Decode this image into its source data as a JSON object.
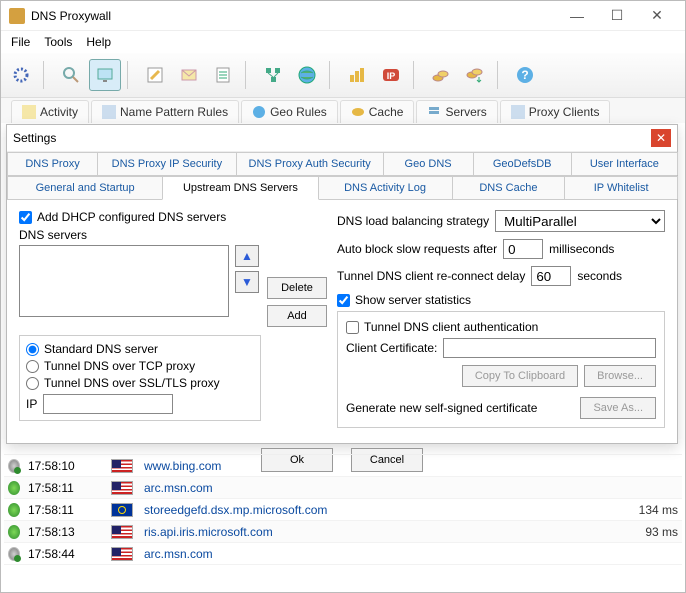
{
  "window": {
    "title": "DNS Proxywall"
  },
  "menu": {
    "file": "File",
    "tools": "Tools",
    "help": "Help"
  },
  "maintabs": {
    "activity": "Activity",
    "name_rules": "Name Pattern Rules",
    "geo_rules": "Geo Rules",
    "cache": "Cache",
    "servers": "Servers",
    "proxy_clients": "Proxy Clients"
  },
  "dialog": {
    "title": "Settings",
    "row1": {
      "dns_proxy": "DNS Proxy",
      "ip_security": "DNS Proxy IP Security",
      "auth_security": "DNS Proxy Auth Security",
      "geo_dns": "Geo DNS",
      "geo_defs": "GeoDefsDB",
      "user_interface": "User Interface"
    },
    "row2": {
      "general": "General and Startup",
      "upstream": "Upstream DNS Servers",
      "activity_log": "DNS Activity Log",
      "dns_cache": "DNS Cache",
      "ip_whitelist": "IP Whitelist"
    },
    "left": {
      "add_dhcp": "Add DHCP configured DNS servers",
      "dns_servers": "DNS servers",
      "delete": "Delete",
      "add": "Add",
      "std": "Standard DNS server",
      "tcp": "Tunnel DNS over TCP proxy",
      "ssl": "Tunnel DNS over SSL/TLS proxy",
      "ip": "IP"
    },
    "right": {
      "load_bal": "DNS load balancing strategy",
      "load_bal_val": "MultiParallel",
      "auto_block": "Auto block slow requests after",
      "auto_block_val": "0",
      "ms": "milliseconds",
      "reconnect": "Tunnel DNS client re-connect delay",
      "reconnect_val": "60",
      "sec": "seconds",
      "show_stats": "Show server statistics",
      "tunnel_auth": "Tunnel DNS client authentication",
      "client_cert": "Client Certificate:",
      "copy": "Copy To Clipboard",
      "browse": "Browse...",
      "gen": "Generate new self-signed certificate",
      "save_as": "Save As..."
    },
    "buttons": {
      "ok": "Ok",
      "cancel": "Cancel"
    }
  },
  "log": [
    {
      "time": "17:58:10",
      "flag": "us",
      "host": "www.bing.com",
      "ms": "",
      "status": "gray"
    },
    {
      "time": "17:58:11",
      "flag": "us",
      "host": "arc.msn.com",
      "ms": "",
      "status": "green"
    },
    {
      "time": "17:58:11",
      "flag": "eu",
      "host": "storeedgefd.dsx.mp.microsoft.com",
      "ms": "134 ms",
      "status": "green"
    },
    {
      "time": "17:58:13",
      "flag": "us",
      "host": "ris.api.iris.microsoft.com",
      "ms": "93 ms",
      "status": "green"
    },
    {
      "time": "17:58:44",
      "flag": "us",
      "host": "arc.msn.com",
      "ms": "",
      "status": "gray"
    }
  ]
}
